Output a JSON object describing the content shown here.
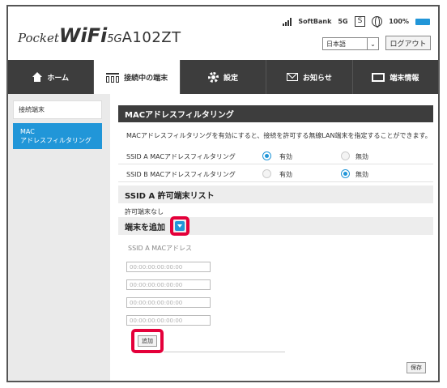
{
  "header": {
    "logo_pocket": "Pocket",
    "logo_wifi": "WiFi",
    "logo_5g": "5G",
    "logo_model": "A102ZT",
    "carrier": "SoftBank",
    "network": "5G",
    "sms_badge": "S",
    "battery_percent": "100%",
    "battery_level": 1.0,
    "language_value": "日本語",
    "logout_label": "ログアウト"
  },
  "nav": {
    "home": "ホーム",
    "devices": "接続中の端末",
    "settings": "設定",
    "notices": "お知らせ",
    "device_info": "端末情報"
  },
  "sidebar": {
    "items": [
      {
        "label": "接続端末"
      },
      {
        "label_line1": "MAC",
        "label_line2": "アドレスフィルタリング"
      }
    ]
  },
  "main": {
    "title": "MACアドレスフィルタリング",
    "description": "MACアドレスフィルタリングを有効にすると、接続を許可する無線LAN端末を指定することができます。",
    "filters": [
      {
        "label": "SSID A MACアドレスフィルタリング",
        "on_label": "有効",
        "off_label": "無効",
        "selected": "on"
      },
      {
        "label": "SSID B MACアドレスフィルタリング",
        "on_label": "有効",
        "off_label": "無効",
        "selected": "off"
      }
    ],
    "allowed_list_title": "SSID A 許可端末リスト",
    "allowed_list_empty": "許可端末なし",
    "add_section_title": "端末を追加",
    "mac_field_label": "SSID A MACアドレス",
    "mac_placeholders": [
      "00:00:00:00:00:00",
      "00:00:00:00:00:00",
      "00:00:00:00:00:00",
      "00:00:00:00:00:00"
    ],
    "add_button": "追加",
    "save_button": "保存"
  },
  "colors": {
    "accent": "#2196d8",
    "nav_bg": "#3d3d3d",
    "highlight": "#e4003a"
  }
}
